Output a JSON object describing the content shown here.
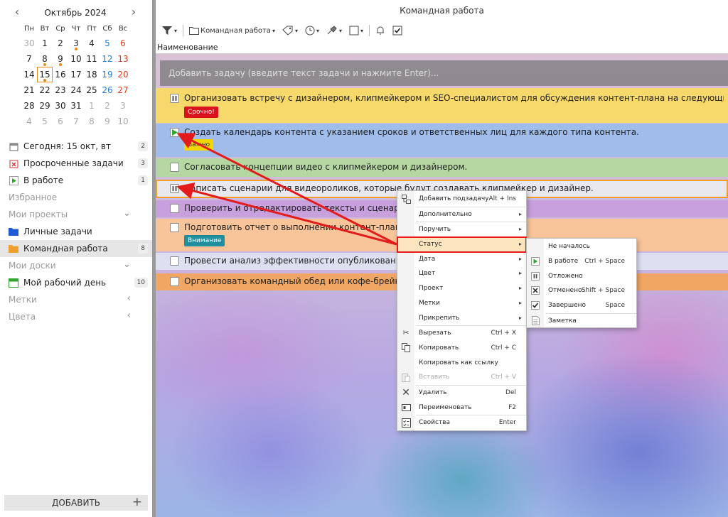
{
  "calendar": {
    "month_title": "Октябрь 2024",
    "weekdays": [
      "Пн",
      "Вт",
      "Ср",
      "Чт",
      "Пт",
      "Сб",
      "Вс"
    ],
    "weeks": [
      [
        "30",
        "1",
        "2",
        "3",
        "4",
        "5",
        "6"
      ],
      [
        "7",
        "8",
        "9",
        "10",
        "11",
        "12",
        "13"
      ],
      [
        "14",
        "15",
        "16",
        "17",
        "18",
        "19",
        "20"
      ],
      [
        "21",
        "22",
        "23",
        "24",
        "25",
        "26",
        "27"
      ],
      [
        "28",
        "29",
        "30",
        "31",
        "1",
        "2",
        "3"
      ],
      [
        "4",
        "5",
        "6",
        "7",
        "8",
        "9",
        "10"
      ]
    ]
  },
  "sidebar": {
    "items": [
      {
        "label": "Сегодня: 15 окт, вт",
        "count": "2",
        "icon": "calendar-icon"
      },
      {
        "label": "Просроченные задачи",
        "count": "3",
        "icon": "overdue-icon"
      },
      {
        "label": "В работе",
        "count": "1",
        "icon": "play-icon"
      },
      {
        "label": "Избранное",
        "section": true
      },
      {
        "label": "Мои проекты",
        "section": true
      },
      {
        "label": "Личные задачи",
        "icon": "folder-blue-icon"
      },
      {
        "label": "Командная работа",
        "count": "8",
        "icon": "folder-orange-icon",
        "active": true
      },
      {
        "label": "Мои доски",
        "section": true
      },
      {
        "label": "Мой рабочий день",
        "count": "10",
        "icon": "board-icon"
      },
      {
        "label": "Метки",
        "section": true
      },
      {
        "label": "Цвета",
        "section": true
      }
    ],
    "add_button": "ДОБАВИТЬ"
  },
  "main": {
    "window_title": "Командная работа",
    "toolbar": {
      "project_label": "Командная работа"
    },
    "column_header": "Наименование",
    "add_task_placeholder": "Добавить задачу (введите текст задачи и нажмите Enter)...",
    "tasks": [
      {
        "text": "Организовать встречу с дизайнером, клипмейкером и SEO-специалистом для обсуждения контент-плана на следующий месяц.",
        "tag": "Срочно!",
        "tag_color": "#d8131b",
        "bg": "#f6d96a",
        "status": "paused"
      },
      {
        "text": "Создать календарь контента с указанием сроков и ответственных лиц для каждого типа контента.",
        "tag": "Важно",
        "tag_color": "#f2d600",
        "bg": "#9fbcea",
        "status": "in-progress"
      },
      {
        "text": "Согласовать концепции видео с клипмейкером и дизайнером.",
        "bg": "#b5d7a2",
        "status": "not-started"
      },
      {
        "text": "Написать сценарии для видеороликов, которые будут создавать клипмейкер и дизайнер.",
        "bg": "#e8e8ee",
        "status": "paused"
      },
      {
        "text": "Проверить и отредактировать тексты и сценарии, п",
        "bg": "#c8a0de",
        "status": "not-started"
      },
      {
        "text": "Подготовить отчет о выполнении контент-плана за                                       ультаты с командой.",
        "tag": "Внимание",
        "tag_color": "#1e8f9e",
        "bg": "#f8c59a",
        "status": "not-started"
      },
      {
        "text": "Провести анализ эффективности опубликованных м                                                                              с SEO-специалистом.",
        "bg": "#dde0f0",
        "status": "not-started"
      },
      {
        "text": "Организовать командный обед или кофе-брейк для                                                                               ланов.",
        "bg": "#f0a764",
        "status": "not-started"
      }
    ]
  },
  "context_menu": {
    "items": [
      {
        "label": "Добавить подзадачу",
        "shortcut": "Alt + Ins",
        "icon": "add-subtask-icon"
      },
      {
        "label": "Дополнительно",
        "submenu": true
      },
      {
        "label": "Поручить",
        "submenu": true
      },
      {
        "label": "Статус",
        "submenu": true,
        "highlighted": true
      },
      {
        "label": "Дата",
        "submenu": true
      },
      {
        "label": "Цвет",
        "submenu": true
      },
      {
        "label": "Проект",
        "submenu": true
      },
      {
        "label": "Метки",
        "submenu": true
      },
      {
        "label": "Прикрепить",
        "submenu": true
      },
      {
        "label": "Вырезать",
        "shortcut": "Ctrl + X",
        "icon": "scissors-icon"
      },
      {
        "label": "Копировать",
        "shortcut": "Ctrl + C",
        "icon": "copy-icon"
      },
      {
        "label": "Копировать как ссылку"
      },
      {
        "label": "Вставить",
        "shortcut": "Ctrl + V",
        "icon": "paste-icon",
        "disabled": true
      },
      {
        "label": "Удалить",
        "shortcut": "Del",
        "icon": "delete-icon"
      },
      {
        "label": "Переименовать",
        "shortcut": "F2",
        "icon": "rename-icon"
      },
      {
        "label": "Свойства",
        "shortcut": "Enter",
        "icon": "properties-icon"
      }
    ]
  },
  "status_submenu": {
    "items": [
      {
        "label": "Не началось",
        "icon": ""
      },
      {
        "label": "В работе",
        "shortcut": "Ctrl + Space",
        "icon": "play-icon"
      },
      {
        "label": "Отложено",
        "icon": "pause-icon"
      },
      {
        "label": "Отменено",
        "shortcut": "Shift + Space",
        "icon": "cancel-icon"
      },
      {
        "label": "Завершено",
        "shortcut": "Space",
        "icon": "check-icon"
      },
      {
        "label": "Заметка",
        "icon": "note-icon"
      }
    ]
  },
  "colors": {
    "accent": "#e88a1a",
    "highlight_border": "#e31b1b",
    "menu_highlight": "#fce4bf"
  }
}
